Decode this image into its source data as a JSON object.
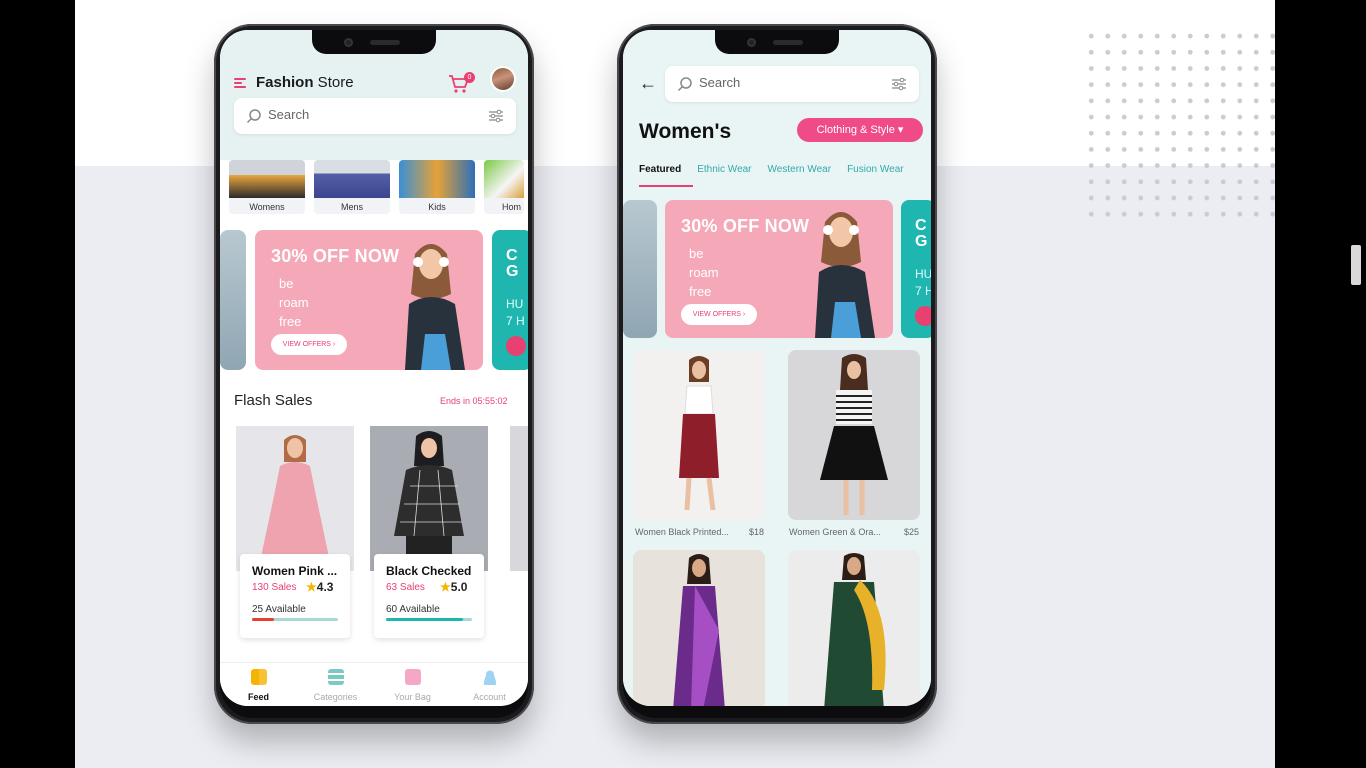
{
  "phone1": {
    "brand_bold": "Fashion",
    "brand_regular": " Store",
    "cart_count": "0",
    "search_placeholder": "Search",
    "categories": [
      {
        "label": "Womens"
      },
      {
        "label": "Mens"
      },
      {
        "label": "Kids"
      },
      {
        "label": "Hom"
      }
    ],
    "banner": {
      "headline": "30% OFF NOW",
      "subline": "be\nroam\nfree",
      "button": "VIEW OFFERS ›"
    },
    "side_banner": {
      "title": "C\nG",
      "text": "HU\n7 H"
    },
    "flash_title": "Flash Sales",
    "flash_end": "Ends in 05:55:02",
    "products": [
      {
        "name": "Women Pink ...",
        "sales": "130 Sales",
        "rating": "4.3",
        "available": "25 Available",
        "progress": 0.25,
        "fill_color": "#e84030"
      },
      {
        "name": "Black Checked",
        "sales": "63 Sales",
        "rating": "5.0",
        "available": "60 Available",
        "progress": 0.9,
        "fill_color": "#1fb6b0"
      }
    ],
    "tabs": [
      {
        "label": "Feed",
        "icon": "feed-icon",
        "active": true
      },
      {
        "label": "Categories",
        "icon": "categories-icon",
        "active": false
      },
      {
        "label": "Your Bag",
        "icon": "bag-icon",
        "active": false
      },
      {
        "label": "Account",
        "icon": "account-icon",
        "active": false
      }
    ]
  },
  "phone2": {
    "search_placeholder": "Search",
    "title": "Women's",
    "chip": "Clothing & Style ▾",
    "filter_tabs": [
      "Featured",
      "Ethnic Wear",
      "Western Wear",
      "Fusion Wear"
    ],
    "banner": {
      "headline": "30% OFF NOW",
      "subline": "be\nroam\nfree",
      "button": "VIEW OFFERS ›"
    },
    "side_banner": {
      "title": "C\nG",
      "text": "HU\n7 H"
    },
    "products": [
      {
        "name": "Women Black Printed...",
        "price": "$18"
      },
      {
        "name": "Women Green & Ora...",
        "price": "$25"
      }
    ]
  },
  "colors": {
    "accent": "#e84070",
    "teal": "#1fb6b0",
    "banner_pink": "#f5a8b7"
  }
}
